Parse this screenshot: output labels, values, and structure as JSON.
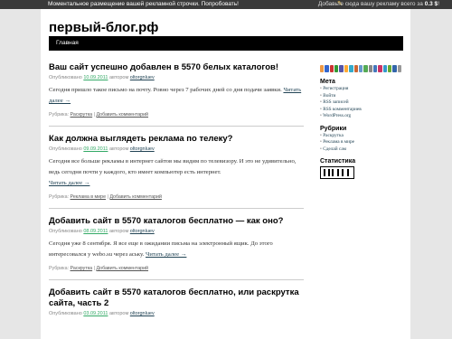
{
  "topbar": {
    "promo": "Моментальное размещение вашей рекламной строчки. Попробовать!",
    "right_text": "Добавьте сюда вашу рекламу всего за",
    "price": "0.3 $",
    "excl": "!"
  },
  "site": {
    "title": "первый-блог.рф"
  },
  "nav": {
    "home": "Главная"
  },
  "posts": [
    {
      "title": "Ваш сайт успешно добавлен в 5570 белых каталогов!",
      "meta_prefix": "Опубликовано",
      "date": "10.09.2011",
      "meta_author_prefix": "автором",
      "author": "oltorgnluev",
      "body": "Сегодня пришло такое письмо на почту. Ровно через 7 рабочих дней со дня подачи заявки.",
      "read_more": "Читать далее →",
      "rubric_prefix": "Рубрика:",
      "rubric": "Раскрутка",
      "separator": "|",
      "comment": "Добавить комментарий"
    },
    {
      "title": "Как должна выглядеть реклама по телеку?",
      "meta_prefix": "Опубликовано",
      "date": "09.09.2011",
      "meta_author_prefix": "автором",
      "author": "oltorgnluev",
      "body": "Сегодня все больше рекламы в интернет сайтов мы видим по телевизору. И это не удивительно, ведь сегодня почти у каждого, кто имеет компьютер есть интернет.",
      "read_more": "Читать далее →",
      "rubric_prefix": "Рубрика:",
      "rubric": "Реклама в мире",
      "separator": "|",
      "comment": "Добавить комментарий"
    },
    {
      "title": "Добавить сайт в 5570 каталогов бесплатно — как оно?",
      "meta_prefix": "Опубликовано",
      "date": "08.09.2011",
      "meta_author_prefix": "автором",
      "author": "oltorgnluev",
      "body": "Сегодня уже 8 сентября. Я все еще в ожидании письма на электронный ящик. До этого интересовался у webo.su через аську.",
      "read_more": "Читать далее →",
      "rubric_prefix": "Рубрика:",
      "rubric": "Раскрутка",
      "separator": "|",
      "comment": "Добавить комментарий"
    },
    {
      "title": "Добавить сайт в 5570 каталогов бесплатно, или раскрутка сайта, часть 2",
      "meta_prefix": "Опубликовано",
      "date": "03.09.2011",
      "meta_author_prefix": "автором",
      "author": "oltorgnluev"
    }
  ],
  "share_icons": [
    {
      "name": "share-icon-1",
      "color": "#e94"
    },
    {
      "name": "share-icon-2",
      "color": "#36c"
    },
    {
      "name": "share-icon-3",
      "color": "#c33"
    },
    {
      "name": "share-icon-4",
      "color": "#393"
    },
    {
      "name": "share-icon-5",
      "color": "#55a"
    },
    {
      "name": "share-icon-6",
      "color": "#fa3"
    },
    {
      "name": "share-icon-7",
      "color": "#3ac"
    },
    {
      "name": "share-icon-8",
      "color": "#c63"
    },
    {
      "name": "share-icon-9",
      "color": "#69c"
    },
    {
      "name": "share-icon-10",
      "color": "#5a5"
    },
    {
      "name": "share-icon-11",
      "color": "#888"
    },
    {
      "name": "share-icon-12",
      "color": "#47b"
    },
    {
      "name": "share-icon-13",
      "color": "#c36"
    },
    {
      "name": "share-icon-14",
      "color": "#39c"
    },
    {
      "name": "share-icon-15",
      "color": "#6a3"
    },
    {
      "name": "share-icon-16",
      "color": "#36a"
    },
    {
      "name": "share-icon-17",
      "color": "#999"
    }
  ],
  "sidebar": {
    "meta": {
      "title": "Мета",
      "items": [
        "Регистрация",
        "Войти",
        "RSS записей",
        "RSS комментариев",
        "WordPress.org"
      ]
    },
    "rubrics": {
      "title": "Рубрики",
      "items": [
        "Раскрутка",
        "Реклама в мире",
        "Сделай сам"
      ]
    },
    "stats": {
      "title": "Статистика"
    }
  }
}
